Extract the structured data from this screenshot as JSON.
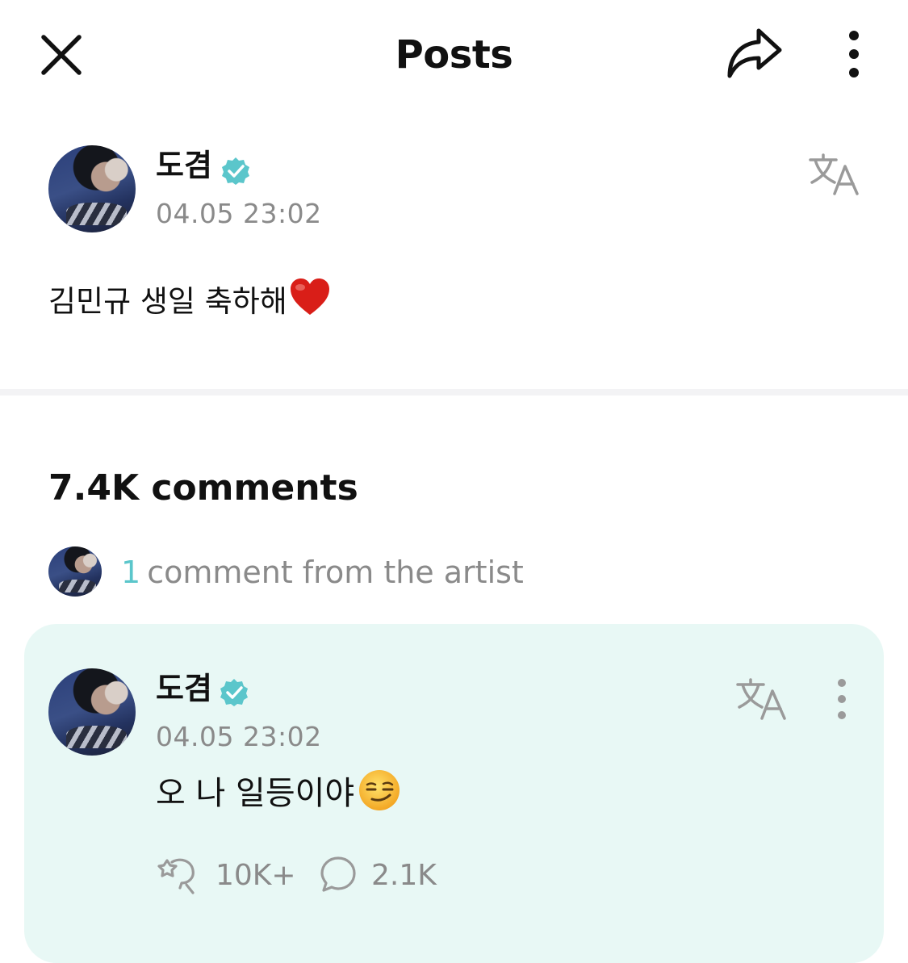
{
  "header": {
    "title": "Posts",
    "close_icon": "close-icon",
    "share_icon": "share-icon",
    "more_icon": "more-vertical-icon"
  },
  "post": {
    "author": "도겸",
    "verified": true,
    "timestamp": "04.05 23:02",
    "body": "김민규 생일 축하해",
    "emoji": "heart",
    "translate_icon": "translate-icon"
  },
  "comments": {
    "count_label": "7.4K comments",
    "artist_count": "1",
    "artist_label": "comment from the artist"
  },
  "artist_comment": {
    "author": "도겸",
    "verified": true,
    "timestamp": "04.05 23:02",
    "body": "오 나 일등이야",
    "emoji": "smirking-face",
    "likes": "10K+",
    "replies": "2.1K",
    "accent_color": "#5bc6cb",
    "card_color": "#e8f8f5"
  }
}
